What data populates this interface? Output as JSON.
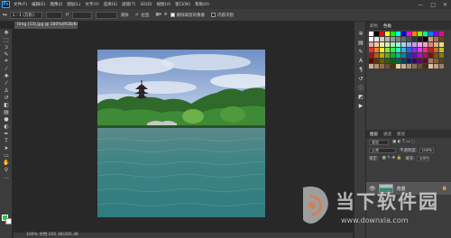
{
  "menubar": {
    "logo": "Ps",
    "items": [
      "文件(F)",
      "编辑(E)",
      "图像(I)",
      "图层(L)",
      "文字(Y)",
      "选择(S)",
      "滤镜(T)",
      "3D(D)",
      "视图(V)",
      "窗口(W)",
      "帮助(H)"
    ],
    "minimize": "—",
    "maximize": "□",
    "close": "✕"
  },
  "options": {
    "ratio": "1 : 1 (方形)",
    "clear": "清除",
    "straighten": "拉直",
    "delete_cropped": "删除裁剪的像素",
    "content_aware": "内容识别"
  },
  "document": {
    "tab": "timg (13).jpg @ 100%(RGB/8#) *",
    "status": "100%    文档:205.3K/205.3K"
  },
  "panels": {
    "swatch_tabs": [
      "颜色",
      "色板"
    ],
    "layer_tabs": [
      "图层",
      "通道",
      "路径"
    ],
    "kind_label": "类型",
    "blend_mode": "正常",
    "opacity_label": "不透明度:",
    "opacity_value": "100%",
    "lock_label": "锁定:",
    "fill_label": "填充:",
    "fill_value": "100%",
    "layer_name": "背景"
  },
  "colors": {
    "foreground": "#20d030",
    "background": "#ffffff"
  },
  "watermark": {
    "brand": "当下软件园",
    "url": "www.downxia.com"
  }
}
